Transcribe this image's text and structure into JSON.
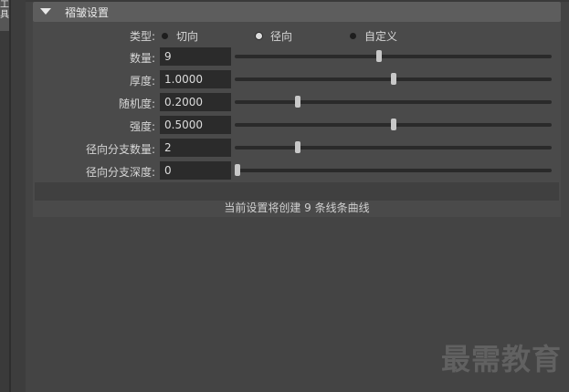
{
  "sidebar": {
    "tab_label": "工具"
  },
  "section": {
    "title": "褶皱设置"
  },
  "type_row": {
    "label": "类型:",
    "options": [
      {
        "label": "切向",
        "selected": false
      },
      {
        "label": "径向",
        "selected": true
      },
      {
        "label": "自定义",
        "selected": false
      }
    ]
  },
  "params": [
    {
      "label": "数量:",
      "value": "9",
      "slider_fraction": 0.455
    },
    {
      "label": "厚度:",
      "value": "1.0000",
      "slider_fraction": 0.5
    },
    {
      "label": "随机度:",
      "value": "0.2000",
      "slider_fraction": 0.2
    },
    {
      "label": "强度:",
      "value": "0.5000",
      "slider_fraction": 0.5
    },
    {
      "label": "径向分支数量:",
      "value": "2",
      "slider_fraction": 0.2
    },
    {
      "label": "径向分支深度:",
      "value": "0",
      "slider_fraction": 0.0
    }
  ],
  "status": {
    "text": "当前设置将创建 9 条线条曲线"
  },
  "watermark": {
    "text": "最需教育"
  },
  "colors": {
    "background": "#444444",
    "header": "#5d5d5d",
    "field": "#2b2b2b",
    "thumb": "#c8c8c8"
  }
}
